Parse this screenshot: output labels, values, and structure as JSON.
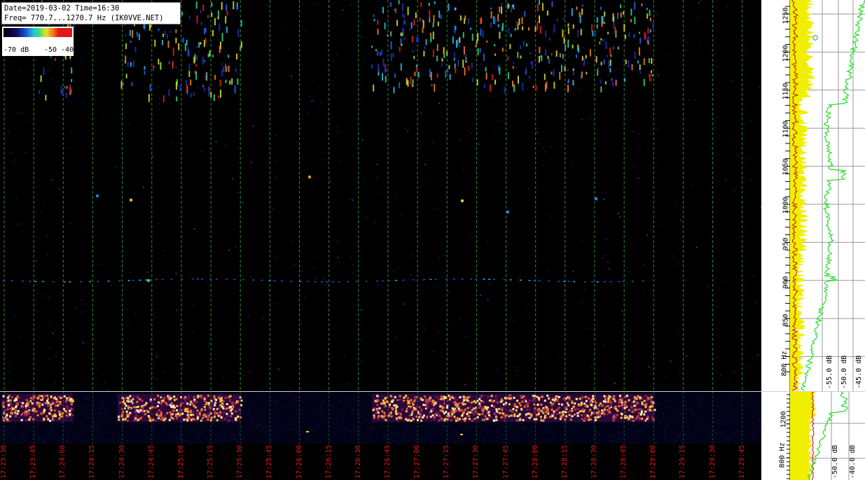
{
  "info": {
    "line1": "Date=2019-03-02 Time=16:30",
    "line2": "Freq= 770.7...1270.7 Hz (IK0VVE.NET)"
  },
  "color_scale": {
    "labels": [
      "-70 dB",
      "-50",
      "-40"
    ],
    "colors": [
      "#000000",
      "#10106a",
      "#1e4fd6",
      "#22c3e0",
      "#3be070",
      "#e8e22a",
      "#f07a1c",
      "#e01818"
    ]
  },
  "freq_axis": {
    "labels": [
      "1250",
      "1200",
      "1150",
      "1100",
      "1050",
      "1000",
      "950",
      "900",
      "850",
      "800 Hz"
    ],
    "values": [
      1250,
      1200,
      1150,
      1100,
      1050,
      1000,
      950,
      900,
      850,
      800
    ]
  },
  "db_axis": {
    "labels": [
      "-55.0 dB",
      "-50.0 dB",
      "-45.0 dB"
    ]
  },
  "mini_freq_axis": {
    "labels": [
      "1200",
      "800 Hz"
    ]
  },
  "mini_db_axis": {
    "labels": [
      "-50.0 dB",
      "-40.0 dB"
    ]
  },
  "time_axis": {
    "labels": [
      "17:23:30",
      "17:23:45",
      "17:24:00",
      "17:24:15",
      "17:24:30",
      "17:24:45",
      "17:25:00",
      "17:25:15",
      "17:25:30",
      "17:25:45",
      "17:26:00",
      "17:26:15",
      "17:26:30",
      "17:26:45",
      "17:27:00",
      "17:27:15",
      "17:27:30",
      "17:27:45",
      "17:28:00",
      "17:28:15",
      "17:28:30",
      "17:28:45",
      "17:29:00",
      "17:29:15",
      "17:29:30",
      "17:29:45"
    ],
    "color": "#d81818"
  },
  "colors": {
    "spectrum_fill": "#f0ef00",
    "spectrum_line": "#cc1111",
    "average_line": "#22dd22",
    "gridline": "#2f8a2f",
    "background": "#000000"
  }
}
